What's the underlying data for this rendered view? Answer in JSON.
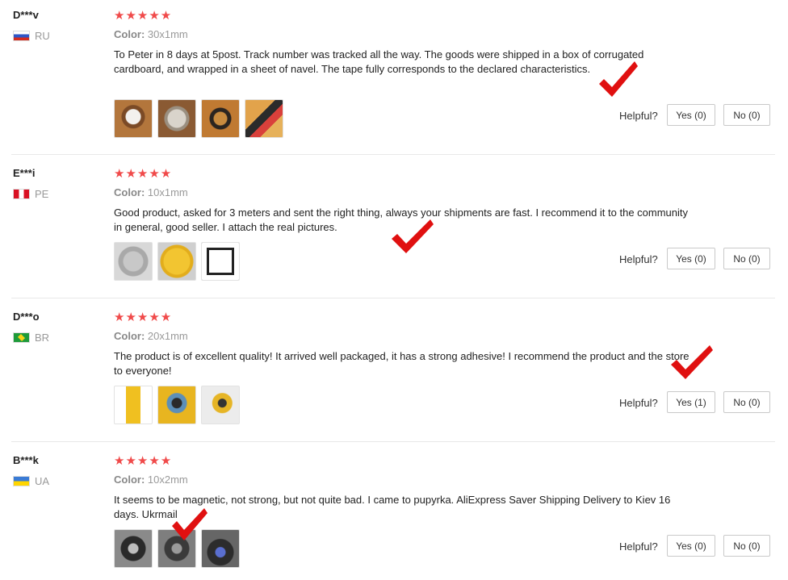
{
  "labels": {
    "helpful": "Helpful?",
    "color_prefix": "Color:"
  },
  "rating_stars": "★★★★★",
  "reviews": [
    {
      "user": "D***v",
      "country": "RU",
      "color": "30x1mm",
      "text": "To Peter in 8 days at 5post. Track number was tracked all the way. The goods were shipped in a box of corrugated cardboard, and wrapped in a sheet of navel. The tape fully corresponds to the declared characteristics.",
      "yes": "Yes (0)",
      "no": "No (0)",
      "rating": 5
    },
    {
      "user": "E***i",
      "country": "PE",
      "color": "10x1mm",
      "text": "Good product, asked for 3 meters and sent the right thing, always your shipments are fast. I recommend it to the community in general, good seller. I attach the real pictures.",
      "yes": "Yes (0)",
      "no": "No (0)",
      "rating": 5
    },
    {
      "user": "D***o",
      "country": "BR",
      "color": "20x1mm",
      "text": "The product is of excellent quality! It arrived well packaged, it has a strong adhesive! I recommend the product and the store to everyone!",
      "yes": "Yes (1)",
      "no": "No (0)",
      "rating": 5
    },
    {
      "user": "B***k",
      "country": "UA",
      "color": "10x2mm",
      "text": "It seems to be magnetic, not strong, but not quite bad. I came to pupyrka. AliExpress Saver Shipping Delivery to Kiev 16 days. Ukrmail",
      "yes": "Yes (0)",
      "no": "No (0)",
      "rating": 5
    }
  ],
  "colors": {
    "star": "#f04a4a",
    "check": "#e01010",
    "border": "#c9c9c9"
  }
}
